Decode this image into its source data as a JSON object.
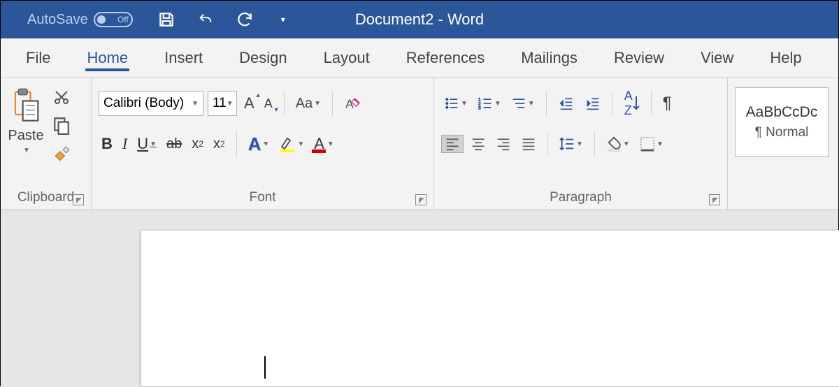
{
  "titlebar": {
    "autosave_label": "AutoSave",
    "autosave_state": "Off",
    "document_title": "Document2  -  Word"
  },
  "tabs": [
    "File",
    "Home",
    "Insert",
    "Design",
    "Layout",
    "References",
    "Mailings",
    "Review",
    "View",
    "Help"
  ],
  "active_tab": "Home",
  "clipboard": {
    "paste": "Paste",
    "group_label": "Clipboard"
  },
  "font": {
    "family": "Calibri (Body)",
    "size": "11",
    "group_label": "Font"
  },
  "paragraph": {
    "group_label": "Paragraph"
  },
  "styles": {
    "preview": "AaBbCcDc",
    "name": "¶ Normal"
  }
}
